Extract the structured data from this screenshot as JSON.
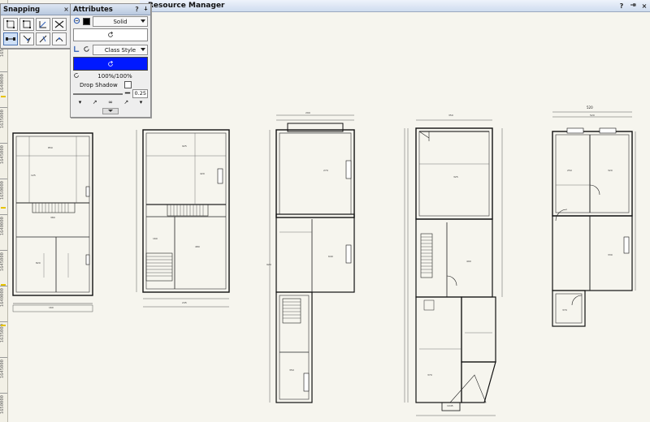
{
  "resource_manager": {
    "title": "Resource Manager",
    "help_icon": "?",
    "pin_icon": "pin",
    "close_icon": "×"
  },
  "snapping_palette": {
    "title": "Snapping",
    "close_icon": "×",
    "buttons": [
      {
        "icon": "snap-to-grid-icon",
        "active": false
      },
      {
        "icon": "snap-to-object-icon",
        "active": false
      },
      {
        "icon": "snap-to-angle-icon",
        "active": false
      },
      {
        "icon": "snap-to-intersection-icon",
        "active": false
      },
      {
        "icon": "snap-to-distance-icon",
        "active": true
      },
      {
        "icon": "smart-points-icon",
        "active": false
      },
      {
        "icon": "smart-edge-icon",
        "active": false
      },
      {
        "icon": "snap-to-surface-icon",
        "active": false
      }
    ]
  },
  "attributes_palette": {
    "title": "Attributes",
    "help_icon": "?",
    "pin_icon": "pin",
    "fill_style": "Solid",
    "fill_color": "#000000",
    "pen_style": "Class Style",
    "pen_color": "#0019ff",
    "opacity": "100%/100%",
    "drop_shadow_label": "Drop Shadow",
    "line_thickness": "0.25",
    "colors": {
      "accent": "#0019ff"
    }
  },
  "ruler": {
    "labels": [
      "1650000",
      "1640000",
      "1635000",
      "1645000",
      "1650000",
      "1640000",
      "1645000",
      "1640000",
      "1635000",
      "1645000",
      "1650000"
    ]
  },
  "drawing": {
    "plan_labels": {
      "p1": [
        "850",
        "125",
        "380",
        "820",
        "160"
      ],
      "p2": [
        "925",
        "420",
        "160",
        "480",
        "245"
      ],
      "p3": [
        "290",
        "270",
        "640",
        "350",
        "920"
      ],
      "p4": [
        "350",
        "325",
        "490",
        "370",
        "1045"
      ],
      "p5": [
        "520",
        "250",
        "320",
        "330",
        "370"
      ],
      "p5_top_dim": "520"
    }
  }
}
